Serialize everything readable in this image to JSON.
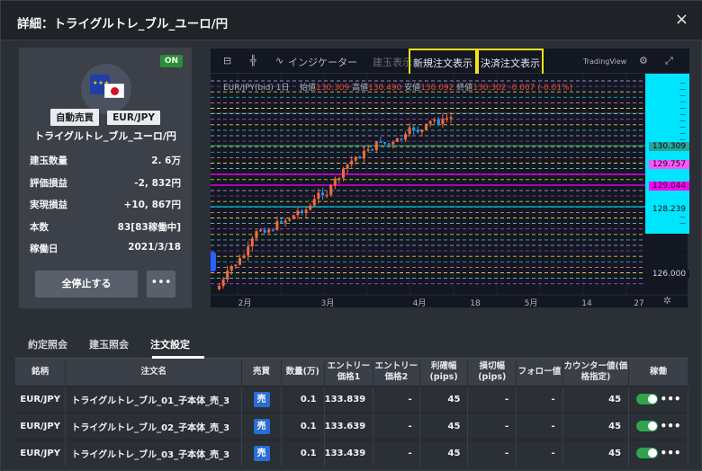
{
  "window": {
    "title": "詳細：トライグルトレ_ブル_ユーロ/円",
    "close_icon": "×"
  },
  "strategy_card": {
    "status": "ON",
    "tag_type": "自動売買",
    "tag_pair": "EUR/JPY",
    "name": "トライグルトレ_ブル_ユーロ/円",
    "stats": [
      {
        "label": "建玉数量",
        "value": "2. 6万"
      },
      {
        "label": "評価損益",
        "value": "-2, 832円"
      },
      {
        "label": "実現損益",
        "value": "+10, 867円"
      },
      {
        "label": "本数",
        "value": "83[83稼働中]"
      },
      {
        "label": "稼働日",
        "value": "2021/3/18"
      }
    ],
    "stop_all_label": "全停止する",
    "more_label": "•••"
  },
  "chart": {
    "toolbar": {
      "indicator_label": "インジケーター",
      "position_label": "建玉表示",
      "new_order_label": "新規注文表示",
      "settle_order_label": "決済注文表示",
      "brand": "TradingView",
      "timeframe": "1日"
    },
    "ohlc": {
      "symbol": "EUR/JPY(bid)",
      "open_label": "始値",
      "open": "130.309",
      "high_label": "高値",
      "high": "130.490",
      "low_label": "安値",
      "low": "130.092",
      "close_label": "終値",
      "close": "130.302",
      "change": "-0.007 (-0.01%)"
    },
    "x_ticks": [
      "2月",
      "3月",
      "4月",
      "18",
      "5月",
      "14",
      "27"
    ],
    "price_labels": [
      {
        "text": "130.309",
        "bg": "#26a69a"
      },
      {
        "text": "129.757",
        "bg": "#ff55ff"
      },
      {
        "text": "129.044",
        "bg": "#ff00ff"
      },
      {
        "text": "128.239",
        "bg": "#00e5ff"
      },
      {
        "text": "126.000",
        "bg": "#131722"
      }
    ],
    "colors": {
      "up": "#f26b3a",
      "down": "#2196f3",
      "bg": "#131722"
    }
  },
  "tabs": [
    {
      "label": "約定照会"
    },
    {
      "label": "建玉照会"
    },
    {
      "label": "注文設定"
    }
  ],
  "table": {
    "headers": [
      "銘柄",
      "注文名",
      "売買",
      "数量(万)",
      "エントリー価格1",
      "エントリー価格2",
      "利確幅(pips)",
      "損切幅(pips)",
      "フォロー値",
      "カウンター値(価格指定)",
      "稼働"
    ],
    "rows": [
      {
        "pair": "EUR/JPY",
        "name": "トライグルトレ_ブル_01_子本体_売_3",
        "side": "売",
        "qty": "0.1",
        "entry1": "133.839",
        "entry2": "-",
        "tp": "45",
        "sl": "-",
        "follow": "-",
        "counter": "45"
      },
      {
        "pair": "EUR/JPY",
        "name": "トライグルトレ_ブル_02_子本体_売_3",
        "side": "売",
        "qty": "0.1",
        "entry1": "133.639",
        "entry2": "-",
        "tp": "45",
        "sl": "-",
        "follow": "-",
        "counter": "45"
      },
      {
        "pair": "EUR/JPY",
        "name": "トライグルトレ_ブル_03_子本体_売_3",
        "side": "売",
        "qty": "0.1",
        "entry1": "133.439",
        "entry2": "-",
        "tp": "45",
        "sl": "-",
        "follow": "-",
        "counter": "45"
      }
    ],
    "active_toggle": "on",
    "row_more": "•••"
  }
}
